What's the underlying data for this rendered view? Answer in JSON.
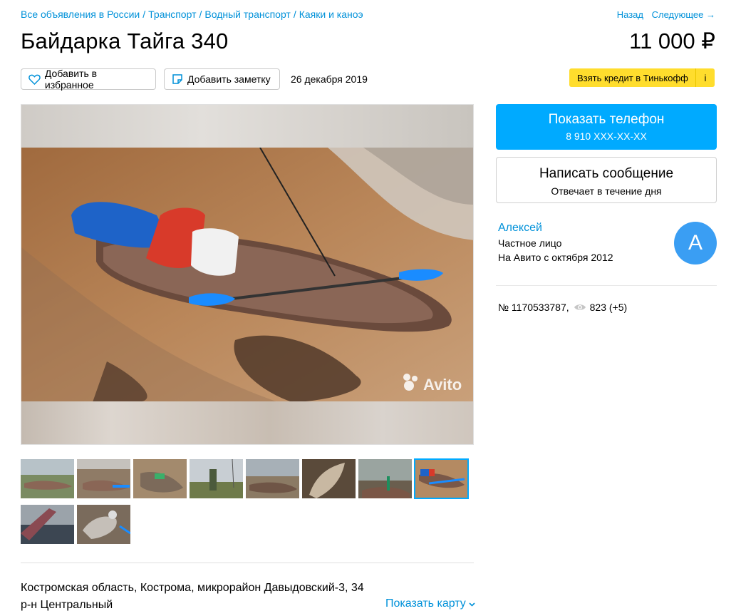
{
  "breadcrumb": {
    "items": [
      "Все объявления в России",
      "Транспорт",
      "Водный транспорт",
      "Каяки и каноэ"
    ],
    "sep": "/"
  },
  "nav": {
    "back": "Назад",
    "next": "Следующее →"
  },
  "listing": {
    "title": "Байдарка Тайга 340",
    "price": "11 000 ₽",
    "date": "26 декабря 2019"
  },
  "actions": {
    "favorite": "Добавить в избранное",
    "note": "Добавить заметку"
  },
  "credit": {
    "label": "Взять кредит в Тинькофф",
    "info": "i"
  },
  "contact": {
    "phone_title": "Показать телефон",
    "phone_masked": "8 910 XXX-XX-XX",
    "message_title": "Написать сообщение",
    "message_sub": "Отвечает в течение дня"
  },
  "seller": {
    "name": "Алексей",
    "type": "Частное лицо",
    "since": "На Авито с октября 2012",
    "avatar_letter": "А"
  },
  "meta": {
    "item_number": "№ 1170533787,",
    "views": "823 (+5)"
  },
  "location": {
    "line1": "Костромская область, Кострома, микрорайон Давыдовский-3, 34",
    "line2": "р-н Центральный",
    "show_map": "Показать карту"
  },
  "gallery": {
    "watermark": "Avito",
    "active_thumb": 8,
    "thumb_count": 10
  },
  "colors": {
    "accent": "#00aaff",
    "link": "#0091d9",
    "credit": "#ffdd2d",
    "avatar": "#3a9ef3"
  }
}
